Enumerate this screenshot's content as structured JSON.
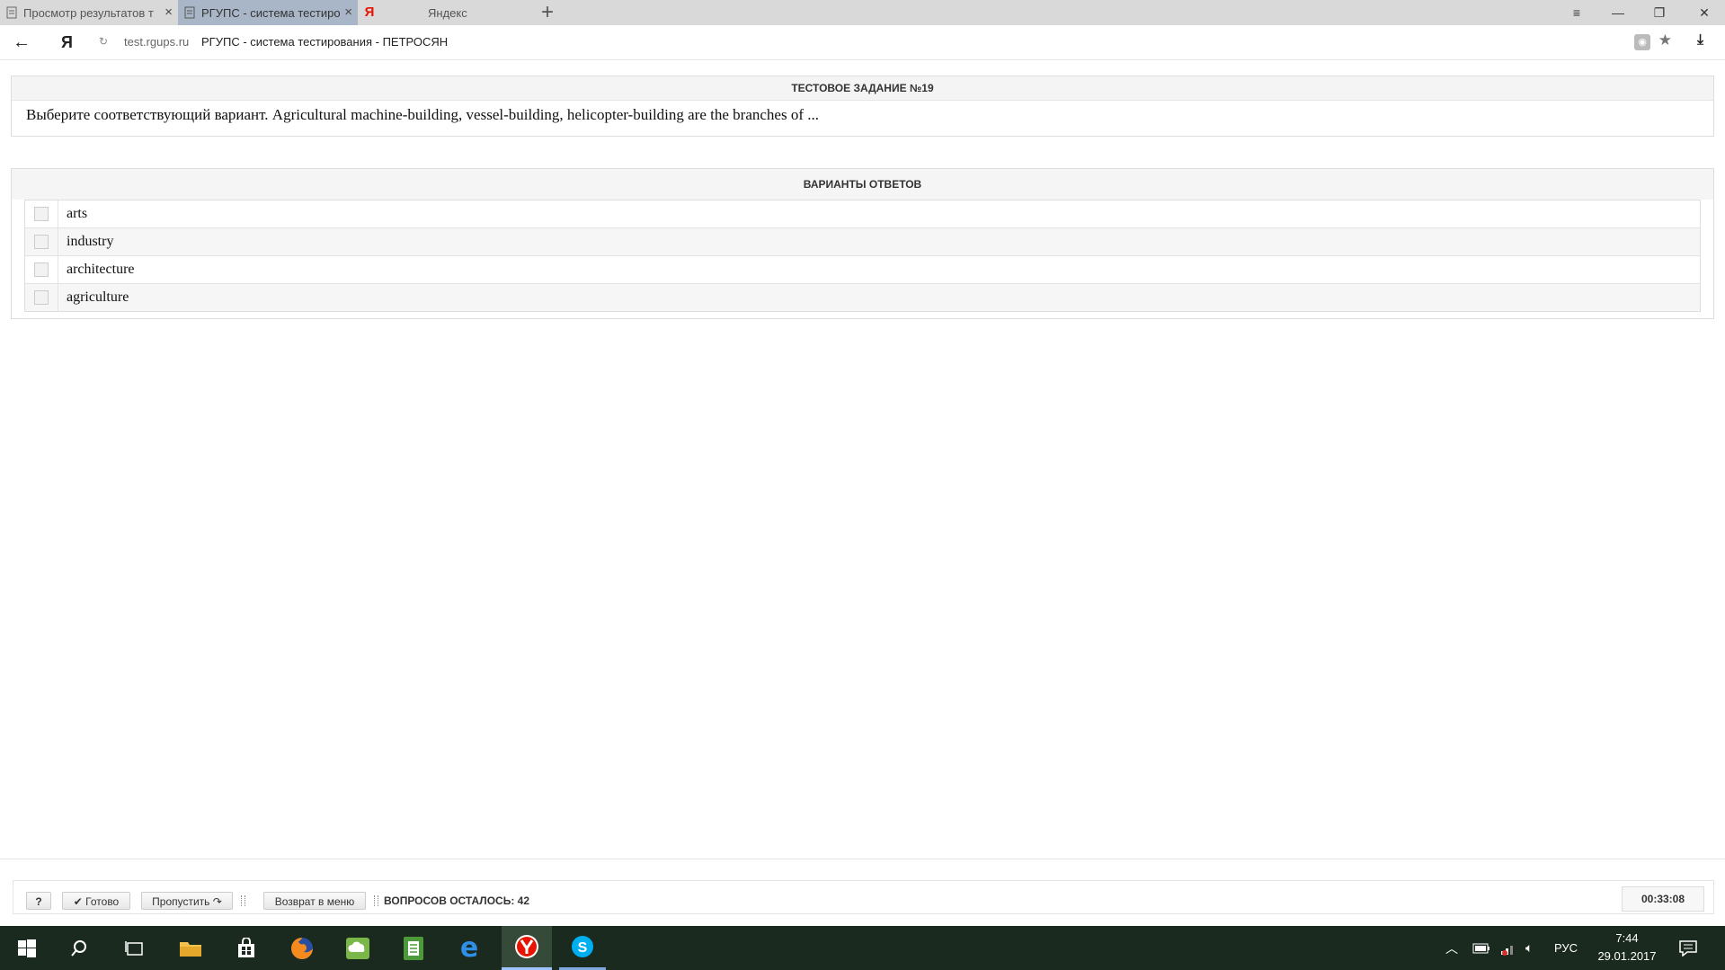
{
  "browser": {
    "tabs": [
      {
        "title": "Просмотр результатов т",
        "favicon": "page-icon"
      },
      {
        "title": "РГУПС - система тестиро",
        "favicon": "page-icon",
        "active": true
      },
      {
        "title": "Яндекс",
        "favicon": "yandex-icon"
      }
    ],
    "ya_button": "Я",
    "address": {
      "domain": "test.rgups.ru",
      "title": "РГУПС - система тестирования - ПЕТРОСЯН"
    }
  },
  "question": {
    "header": "ТЕСТОВОЕ ЗАДАНИЕ №19",
    "text": "Выберите соответствующий вариант. Agricultural machine-building, vessel-building, helicopter-building are the branches of  ..."
  },
  "answers": {
    "header": "ВАРИАНТЫ ОТВЕТОВ",
    "options": [
      "arts",
      "industry",
      "architecture",
      "agriculture"
    ]
  },
  "footer": {
    "help_label": "?",
    "done_label": "Готово",
    "skip_label": "Пропустить",
    "menu_label": "Возврат в меню",
    "remaining_label": "ВОПРОСОВ ОСТАЛОСЬ: 42",
    "timer": "00:33:08"
  },
  "taskbar": {
    "language": "РУС",
    "time": "7:44",
    "date": "29.01.2017"
  },
  "colors": {
    "tab_active": "#a8b6c8",
    "taskbar": "#1b2a1f",
    "yandex_red": "#e61400",
    "skype_blue": "#00aff0"
  }
}
